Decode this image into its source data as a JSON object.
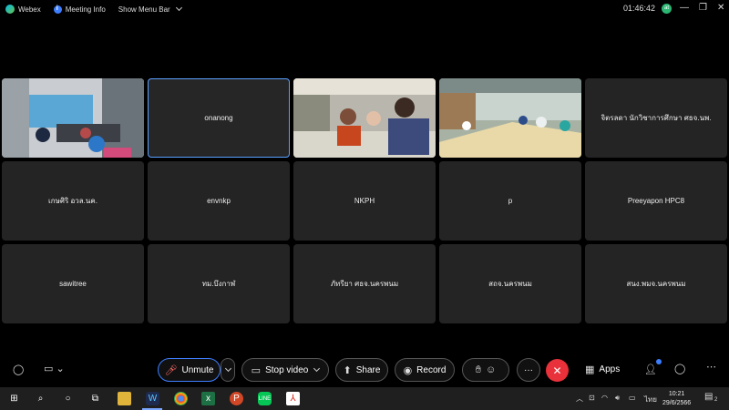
{
  "topbar": {
    "app_name": "Webex",
    "meeting_info": "Meeting Info",
    "menu_bar": "Show Menu Bar",
    "timer": "01:46:42",
    "status_initial": "at"
  },
  "participants": [
    {
      "name": "",
      "video": true
    },
    {
      "name": "onanong",
      "video": false,
      "active_speaker": true
    },
    {
      "name": "",
      "video": true
    },
    {
      "name": "",
      "video": true
    },
    {
      "name": "จิตรลดา นักวิชาการศึกษา ศธจ.นพ.",
      "video": false
    },
    {
      "name": "เกษศิริ อวล.นค.",
      "video": false
    },
    {
      "name": "envnkp",
      "video": false
    },
    {
      "name": "NKPH",
      "video": false
    },
    {
      "name": "p",
      "video": false
    },
    {
      "name": "Preeyapon HPC8",
      "video": false
    },
    {
      "name": "sawitree",
      "video": false
    },
    {
      "name": "ทม.บึงกาฬ",
      "video": false
    },
    {
      "name": "ภัทรียา ศธจ.นครพนม",
      "video": false
    },
    {
      "name": "สถจ.นครพนม",
      "video": false
    },
    {
      "name": "สนง.พมจ.นครพนม",
      "video": false
    }
  ],
  "controls": {
    "unmute": "Unmute",
    "stop_video": "Stop video",
    "share": "Share",
    "record": "Record",
    "more": "···",
    "end": "✕",
    "apps": "Apps"
  },
  "taskbar": {
    "time": "10:21",
    "date": "29/6/2566",
    "language": "ไทย",
    "notifications": "2"
  },
  "colors": {
    "accent": "#3d7eff",
    "end_call": "#e8313a",
    "tile_bg": "#242424"
  }
}
